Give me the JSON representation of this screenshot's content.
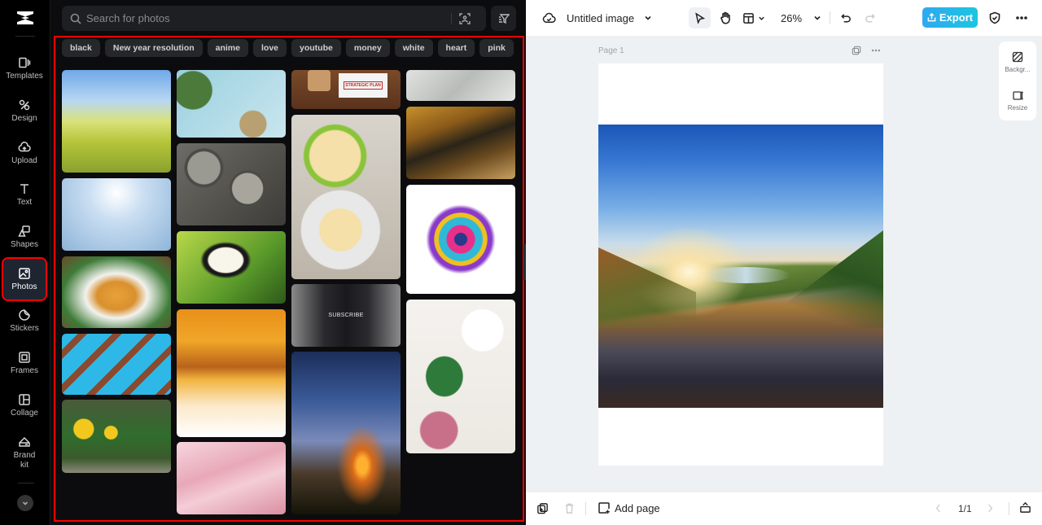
{
  "rail": {
    "items": [
      {
        "label": "Templates",
        "icon": "templates-icon"
      },
      {
        "label": "Design",
        "icon": "design-icon"
      },
      {
        "label": "Upload",
        "icon": "upload-cloud-icon"
      },
      {
        "label": "Text",
        "icon": "text-icon"
      },
      {
        "label": "Shapes",
        "icon": "shapes-icon"
      },
      {
        "label": "Photos",
        "icon": "photo-icon",
        "active": true
      },
      {
        "label": "Stickers",
        "icon": "sticker-icon"
      },
      {
        "label": "Frames",
        "icon": "frame-icon"
      },
      {
        "label": "Collage",
        "icon": "collage-icon"
      },
      {
        "label": "Brand kit",
        "icon": "brand-kit-icon"
      }
    ]
  },
  "photos_panel": {
    "search": {
      "placeholder": "Search for photos",
      "value": ""
    },
    "chips": [
      "black",
      "New year resolution",
      "anime",
      "love",
      "youtube",
      "money",
      "white",
      "heart",
      "pink"
    ],
    "photos": {
      "col1": [
        "Yellow flower meadow under blue sky",
        "Light blue bokeh background",
        "Bowl of chickpea salad on checkered cloth",
        "Pattern of chocolate hearts on blue background",
        "Sunflowers and potted flowers"
      ],
      "col2": [
        "Christmas decorations on light blue",
        "Stack of coins",
        "Butterfly on green leaf",
        "Orange and white abstract wave",
        "Pink silk fabric"
      ],
      "col3": [
        "Rubber stamp with Strategic Plan paper",
        "Kiwi strawberry tart slices",
        "Businessman holding Subscribe screen",
        "Sunset over forest with sun rays"
      ],
      "col4": [
        "White tropical leaves",
        "Lizard on rock",
        "Colorful symmetrical lion art",
        "White orchid botanical illustration"
      ]
    },
    "subscribe_text": "SUBSCRIBE",
    "stamp_text": "STRATEGIC PLAN"
  },
  "header": {
    "doc_title": "Untitled image",
    "zoom": "26%",
    "export_label": "Export",
    "accent_color": "#1fb8e6"
  },
  "canvas": {
    "page_label": "Page 1",
    "photo": "Mountain valley landscape at sunrise with river"
  },
  "side_tools": [
    {
      "label": "Backgr...",
      "icon": "background-icon"
    },
    {
      "label": "Resize",
      "icon": "resize-icon"
    }
  ],
  "footer": {
    "add_page_label": "Add page",
    "page_indicator": "1/1"
  }
}
